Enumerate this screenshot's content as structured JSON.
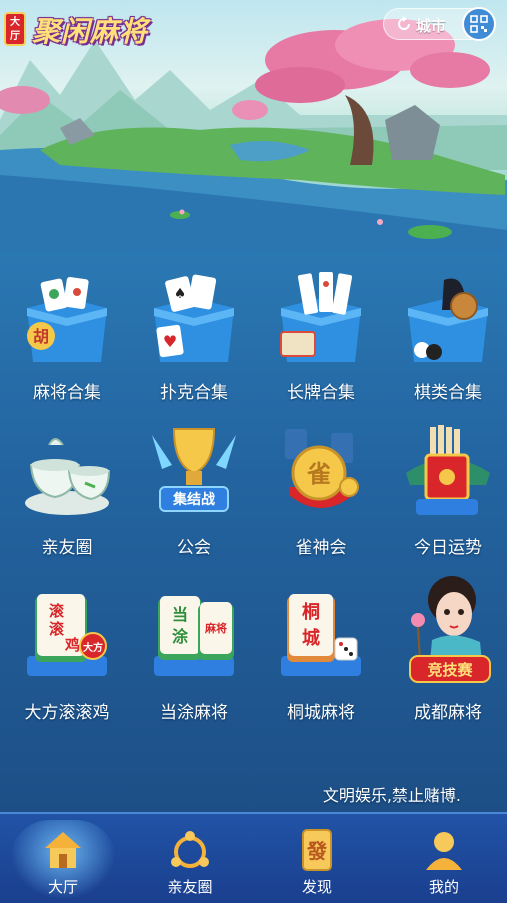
{
  "header": {
    "logo_badge": "大厅",
    "logo_title": "聚闲麻将",
    "city_label": "城市",
    "refresh_icon": "refresh-icon",
    "qr_icon": "qr-code-icon"
  },
  "games": [
    {
      "label": "麻将合集",
      "icon": "mahjong-box-icon"
    },
    {
      "label": "扑克合集",
      "icon": "poker-box-icon"
    },
    {
      "label": "长牌合集",
      "icon": "long-card-box-icon"
    },
    {
      "label": "棋类合集",
      "icon": "chess-box-icon"
    },
    {
      "label": "亲友圈",
      "icon": "tea-set-icon"
    },
    {
      "label": "公会",
      "icon": "trophy-icon",
      "badge": "集结战"
    },
    {
      "label": "雀神会",
      "icon": "gold-coin-icon",
      "badge": "雀"
    },
    {
      "label": "今日运势",
      "icon": "fortune-box-icon"
    },
    {
      "label": "大方滚滚鸡",
      "icon": "mahjong-tile-icon",
      "tile_text": [
        "滚",
        "滚",
        "鸡"
      ],
      "badge": "大方"
    },
    {
      "label": "当涂麻将",
      "icon": "mahjong-tile-icon",
      "tile_text": [
        "当",
        "涂"
      ],
      "badge": "麻将"
    },
    {
      "label": "桐城麻将",
      "icon": "mahjong-tile-icon",
      "tile_text": [
        "桐",
        "城"
      ]
    },
    {
      "label": "成都麻将",
      "icon": "girl-character-icon",
      "badge": "竞技赛"
    }
  ],
  "notice": "文明娱乐,禁止赌博.",
  "nav": [
    {
      "label": "大厅",
      "icon": "house-icon",
      "active": true
    },
    {
      "label": "亲友圈",
      "icon": "circle-share-icon",
      "active": false
    },
    {
      "label": "发现",
      "icon": "fa-tile-icon",
      "tile_char": "發",
      "active": false
    },
    {
      "label": "我的",
      "icon": "user-icon",
      "active": false
    }
  ],
  "colors": {
    "accent": "#2a78b3",
    "nav_bg": "#1a3f8e",
    "badge_red": "#d8262a",
    "gold": "#f5c84a"
  }
}
